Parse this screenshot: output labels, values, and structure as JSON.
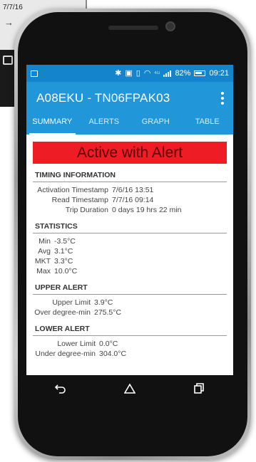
{
  "background": {
    "paper_date": "7/7/16"
  },
  "statusbar": {
    "signal_label": "4G",
    "battery_percent": "82%",
    "time": "09:21"
  },
  "toolbar": {
    "title": "A08EKU - TN06FPAK03"
  },
  "tabs": [
    {
      "label": "SUMMARY",
      "active": true
    },
    {
      "label": "ALERTS",
      "active": false
    },
    {
      "label": "GRAPH",
      "active": false
    },
    {
      "label": "TABLE",
      "active": false
    }
  ],
  "alert_banner": {
    "text": "Active with Alert",
    "color": "#ee1c25"
  },
  "timing": {
    "heading": "TIMING INFORMATION",
    "rows": [
      {
        "label": "Activation Timestamp",
        "value": "7/6/16 13:51"
      },
      {
        "label": "Read Timestamp",
        "value": "7/7/16 09:14"
      },
      {
        "label": "Trip Duration",
        "value": "0 days 19 hrs 22 min"
      }
    ]
  },
  "statistics": {
    "heading": "STATISTICS",
    "rows": [
      {
        "label": "Min",
        "value": "-3.5°C"
      },
      {
        "label": "Avg",
        "value": "3.1°C"
      },
      {
        "label": "MKT",
        "value": "3.3°C"
      },
      {
        "label": "Max",
        "value": "10.0°C"
      }
    ]
  },
  "upper_alert": {
    "heading": "UPPER ALERT",
    "rows": [
      {
        "label": "Upper Limit",
        "value": "3.9°C"
      },
      {
        "label": "Over degree-min",
        "value": "275.5°C"
      }
    ]
  },
  "lower_alert": {
    "heading": "LOWER ALERT",
    "rows": [
      {
        "label": "Lower Limit",
        "value": "0.0°C"
      },
      {
        "label": "Under degree-min",
        "value": "304.0°C"
      }
    ]
  },
  "navbar": {
    "icons": [
      "back-icon",
      "home-icon",
      "recents-icon"
    ]
  },
  "colors": {
    "statusbar": "#1485cc",
    "toolbar": "#2196d8",
    "alert_red": "#ee1c25"
  }
}
